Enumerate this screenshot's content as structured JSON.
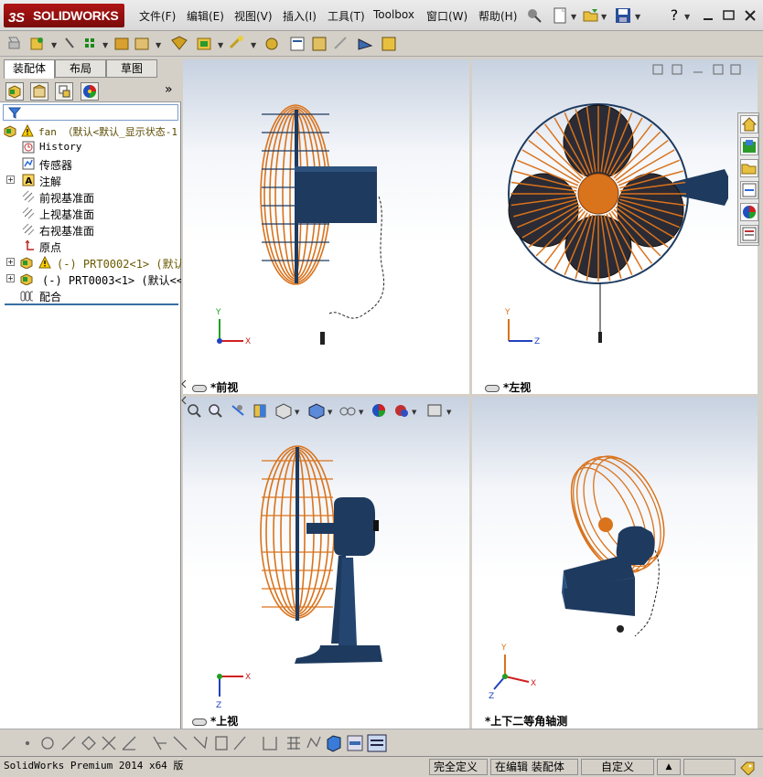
{
  "app": {
    "logo_text": "SOLIDWORKS",
    "logo_mark": "3S"
  },
  "menu": [
    "文件(F)",
    "编辑(E)",
    "视图(V)",
    "插入(I)",
    "工具(T)",
    "Toolbox",
    "窗口(W)",
    "帮助(H)"
  ],
  "left_tabs": [
    "装配体",
    "布局",
    "草图"
  ],
  "tree": {
    "root": "fan （默认<默认_显示状态-1",
    "items": [
      {
        "label": "History",
        "mono": true
      },
      {
        "label": "传感器"
      },
      {
        "label": "注解",
        "expandable": true
      },
      {
        "label": "前视基准面"
      },
      {
        "label": "上视基准面"
      },
      {
        "label": "右视基准面"
      },
      {
        "label": "原点"
      },
      {
        "label": "(-) PRT0002<1> (默认<默",
        "mono": true,
        "expandable": true,
        "warning": true
      },
      {
        "label": "(-) PRT0003<1> (默认<<默认",
        "mono": true,
        "expandable": true
      },
      {
        "label": "配合"
      }
    ]
  },
  "views": [
    {
      "name": "*前视",
      "axes": [
        "Y",
        "X"
      ]
    },
    {
      "name": "*左视",
      "axes": [
        "Y",
        "Z"
      ]
    },
    {
      "name": "*上视",
      "axes": [
        "X",
        "Z"
      ]
    },
    {
      "name": "*上下二等角轴测",
      "axes": [
        "Y",
        "X",
        "Z"
      ]
    }
  ],
  "status": {
    "product": "SolidWorks Premium 2014 x64 版",
    "definition": "完全定义",
    "editing": "在编辑 装配体",
    "custom": "自定义"
  },
  "colors": {
    "fan_guard": "#d9731c",
    "fan_body": "#1e3a5f",
    "accent": "#b01515"
  },
  "icons": {
    "panel_expand": "»"
  }
}
